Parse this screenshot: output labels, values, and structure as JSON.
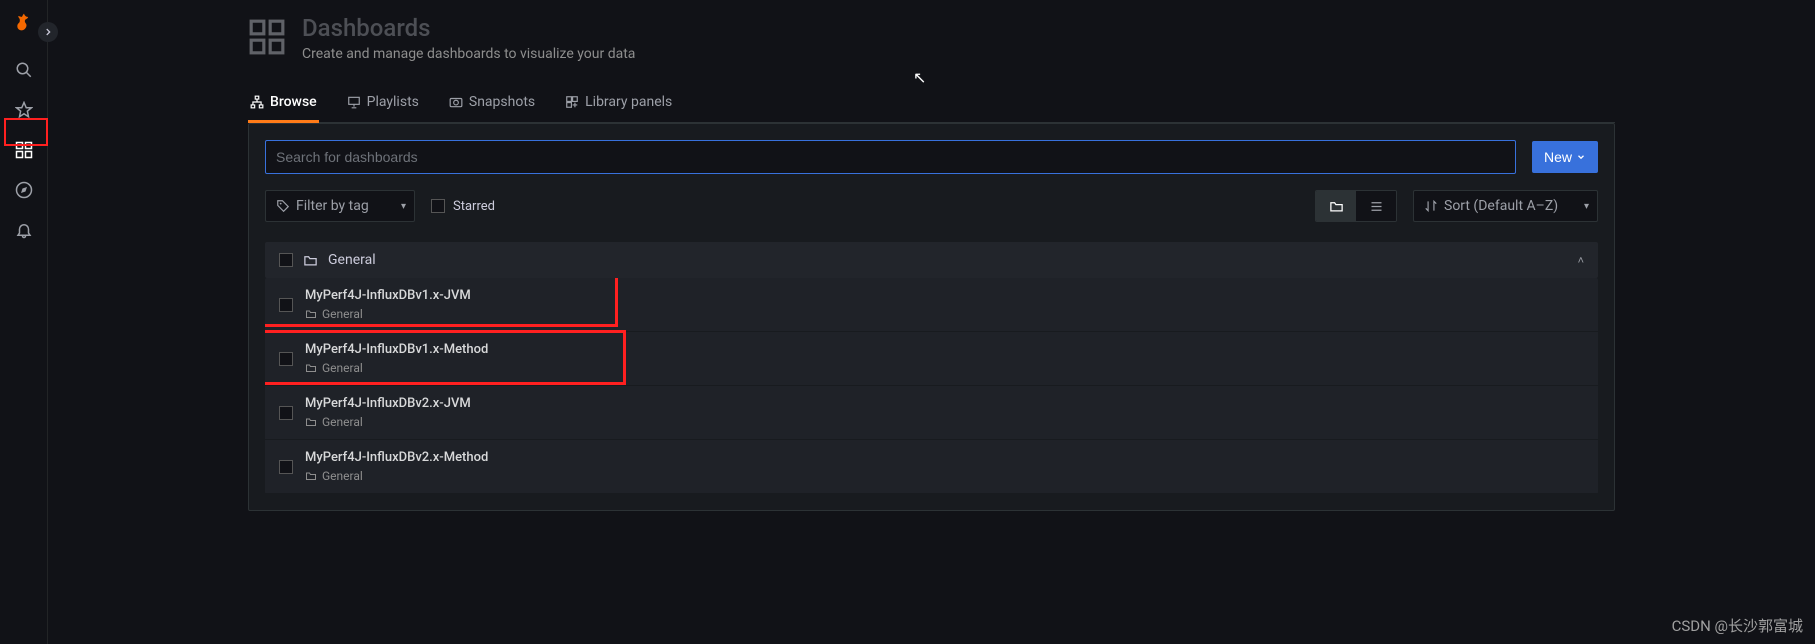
{
  "sidebar": {
    "items": [
      {
        "name": "logo",
        "icon": "grafana"
      },
      {
        "name": "search",
        "icon": "search"
      },
      {
        "name": "starred",
        "icon": "star"
      },
      {
        "name": "dashboards",
        "icon": "apps"
      },
      {
        "name": "explore",
        "icon": "compass"
      },
      {
        "name": "alerting",
        "icon": "bell"
      }
    ]
  },
  "header": {
    "title": "Dashboards",
    "subtitle": "Create and manage dashboards to visualize your data"
  },
  "tabs": [
    {
      "label": "Browse",
      "active": true
    },
    {
      "label": "Playlists",
      "active": false
    },
    {
      "label": "Snapshots",
      "active": false
    },
    {
      "label": "Library panels",
      "active": false
    }
  ],
  "toolbar": {
    "search_placeholder": "Search for dashboards",
    "search_value": "",
    "new_label": "New",
    "filter_tag_label": "Filter by tag",
    "starred_label": "Starred",
    "sort_label": "Sort (Default A–Z)"
  },
  "folder": {
    "name": "General"
  },
  "dashboards": [
    {
      "title": "MyPerf4J-InfluxDBv1.x-JVM",
      "folder": "General",
      "highlighted": true
    },
    {
      "title": "MyPerf4J-InfluxDBv1.x-Method",
      "folder": "General",
      "highlighted": true
    },
    {
      "title": "MyPerf4J-InfluxDBv2.x-JVM",
      "folder": "General",
      "highlighted": false
    },
    {
      "title": "MyPerf4J-InfluxDBv2.x-Method",
      "folder": "General",
      "highlighted": false
    }
  ],
  "watermark": "CSDN @长沙郭富城"
}
